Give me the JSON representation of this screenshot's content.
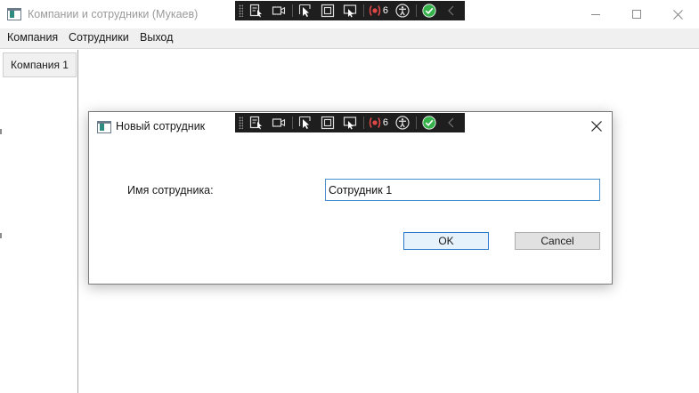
{
  "window": {
    "title": "Компании и сотрудники (Мукаев)"
  },
  "menu": {
    "items": [
      "Компания",
      "Сотрудники",
      "Выход"
    ]
  },
  "sidebar": {
    "companies": [
      "Компания 1"
    ]
  },
  "debug_toolbar": {
    "binding_failures_count": "6",
    "icons": [
      "select-element-icon",
      "video-record-icon",
      "pointer-select-icon",
      "display-layout-icon",
      "track-focus-icon",
      "binding-failures-icon",
      "accessibility-icon",
      "check-icon",
      "collapse-chevron-icon"
    ]
  },
  "dialog": {
    "title": "Новый сотрудник",
    "name_label": "Имя сотрудника:",
    "name_value": "Сотрудник 1",
    "ok_label": "OK",
    "cancel_label": "Cancel"
  },
  "colors": {
    "accent_border": "#2a78c8",
    "toolbar_bg": "#1e1e1e",
    "check_green": "#36b24a",
    "binding_red": "#e04848"
  }
}
